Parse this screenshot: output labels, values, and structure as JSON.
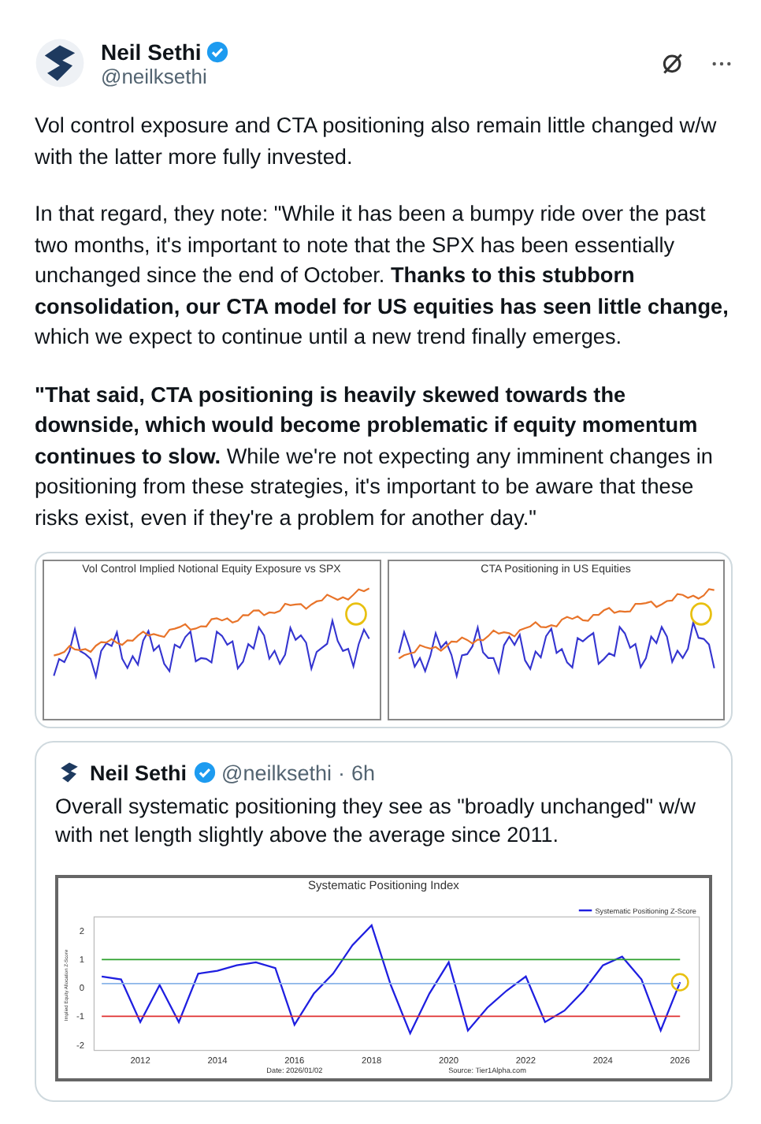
{
  "tweet": {
    "author": {
      "name": "Neil Sethi",
      "verified": true,
      "handle": "@neilksethi"
    },
    "paragraphs": [
      "Vol control exposure and CTA positioning also remain little changed w/w with the latter more fully invested.",
      "In that regard, they note: \"While it has been a bumpy ride over the past two months, it's important to note that the SPX has been essentially unchanged since the end of October. **Thanks to this stubborn consolidation, our CTA model for US equities has seen little change,** which we expect to continue until a new trend finally emerges.",
      "**\"That said, CTA positioning is heavily skewed towards the downside, which would become problematic if equity momentum continues to slow.** While we're not expecting any imminent changes in positioning from these strategies, it's important to be aware that these risks exist, even if they're a problem for another day.\""
    ],
    "images": [
      {
        "title": "Vol Control Implied Notional Equity Exposure vs SPX"
      },
      {
        "title": "CTA Positioning in US Equities"
      }
    ],
    "quote": {
      "author": {
        "name": "Neil Sethi",
        "verified": true,
        "handle": "@neilksethi",
        "separator": "·",
        "time": "6h"
      },
      "text": "Overall systematic positioning they see as \"broadly unchanged\" w/w with net length slightly above the average since 2011.",
      "chart": {
        "chart_data": {
          "type": "line",
          "title": "Systematic Positioning Index",
          "ylabel": "Implied Equity Allocation Z-Score",
          "x": [
            2011,
            2011.5,
            2012,
            2012.5,
            2013,
            2013.5,
            2014,
            2014.5,
            2015,
            2015.5,
            2016,
            2016.5,
            2017,
            2017.5,
            2018,
            2018.5,
            2019,
            2019.5,
            2020,
            2020.5,
            2021,
            2021.5,
            2022,
            2022.5,
            2023,
            2023.5,
            2024,
            2024.5,
            2025,
            2025.5,
            2026
          ],
          "series": [
            {
              "name": "Systematic Positioning Z-Score",
              "color": "#1f1fe0",
              "values": [
                0.4,
                0.3,
                -1.2,
                0.1,
                -1.2,
                0.5,
                0.6,
                0.8,
                0.9,
                0.7,
                -1.3,
                -0.2,
                0.5,
                1.5,
                2.2,
                0.1,
                -1.6,
                -0.2,
                0.9,
                -1.5,
                -0.7,
                -0.1,
                0.4,
                -1.2,
                -0.8,
                -0.1,
                0.8,
                1.1,
                0.3,
                -1.5,
                0.2
              ]
            },
            {
              "color": "#2ca02c",
              "values": [
                1,
                1,
                1,
                1,
                1,
                1,
                1,
                1,
                1,
                1,
                1,
                1,
                1,
                1,
                1,
                1,
                1,
                1,
                1,
                1,
                1,
                1,
                1,
                1,
                1,
                1,
                1,
                1,
                1,
                1,
                1
              ]
            },
            {
              "color": "#e03030",
              "values": [
                -1,
                -1,
                -1,
                -1,
                -1,
                -1,
                -1,
                -1,
                -1,
                -1,
                -1,
                -1,
                -1,
                -1,
                -1,
                -1,
                -1,
                -1,
                -1,
                -1,
                -1,
                -1,
                -1,
                -1,
                -1,
                -1,
                -1,
                -1,
                -1,
                -1,
                -1
              ]
            },
            {
              "color": "#8ab4e8",
              "values": [
                0.15,
                0.15,
                0.15,
                0.15,
                0.15,
                0.15,
                0.15,
                0.15,
                0.15,
                0.15,
                0.15,
                0.15,
                0.15,
                0.15,
                0.15,
                0.15,
                0.15,
                0.15,
                0.15,
                0.15,
                0.15,
                0.15,
                0.15,
                0.15,
                0.15,
                0.15,
                0.15,
                0.15,
                0.15,
                0.15,
                0.15
              ]
            }
          ],
          "xlim": [
            2010.8,
            2026.5
          ],
          "ylim": [
            -2.2,
            2.5
          ],
          "xticks": [
            2012,
            2014,
            2016,
            2018,
            2020,
            2022,
            2024,
            2026
          ],
          "yticks": [
            -2,
            -1,
            0,
            1,
            2
          ]
        },
        "date": "Date: 2026/01/02",
        "source": "Source: Tier1Alpha.com"
      }
    }
  }
}
